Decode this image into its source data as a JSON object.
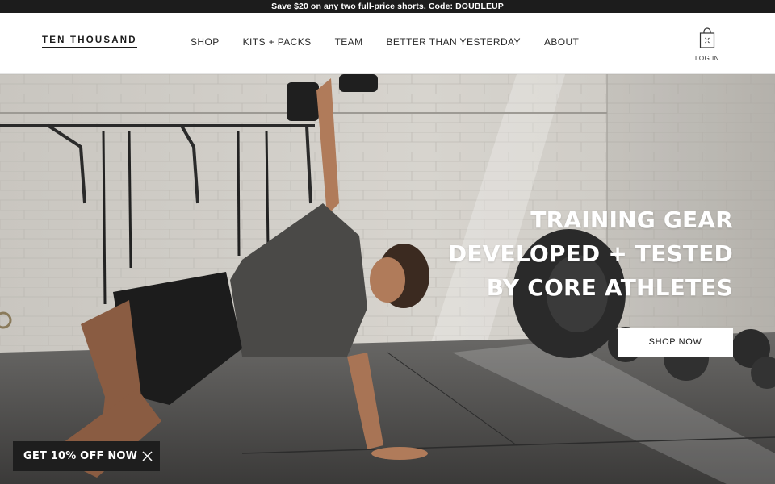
{
  "announcement": {
    "text": "Save $20 on any two full-price shorts. Code: DOUBLEUP"
  },
  "header": {
    "logo": "TEN THOUSAND",
    "nav": [
      {
        "label": "SHOP"
      },
      {
        "label": "KITS + PACKS"
      },
      {
        "label": "TEAM"
      },
      {
        "label": "BETTER THAN YESTERDAY"
      },
      {
        "label": "ABOUT"
      }
    ],
    "cart_icon": "shopping-bag-icon",
    "login_label": "LOG IN"
  },
  "hero": {
    "headline": [
      "TRAINING GEAR",
      "DEVELOPED + TESTED",
      "BY CORE ATHLETES"
    ],
    "cta_label": "SHOP NOW",
    "image": "athlete-gym-photo"
  },
  "discount_popup": {
    "label": "GET 10% OFF NOW",
    "close_icon": "close-icon"
  },
  "colors": {
    "announcement_bg": "#1c1c1c",
    "header_bg": "#ffffff",
    "cta_bg": "#ffffff",
    "popup_bg": "#1e1e1e"
  }
}
